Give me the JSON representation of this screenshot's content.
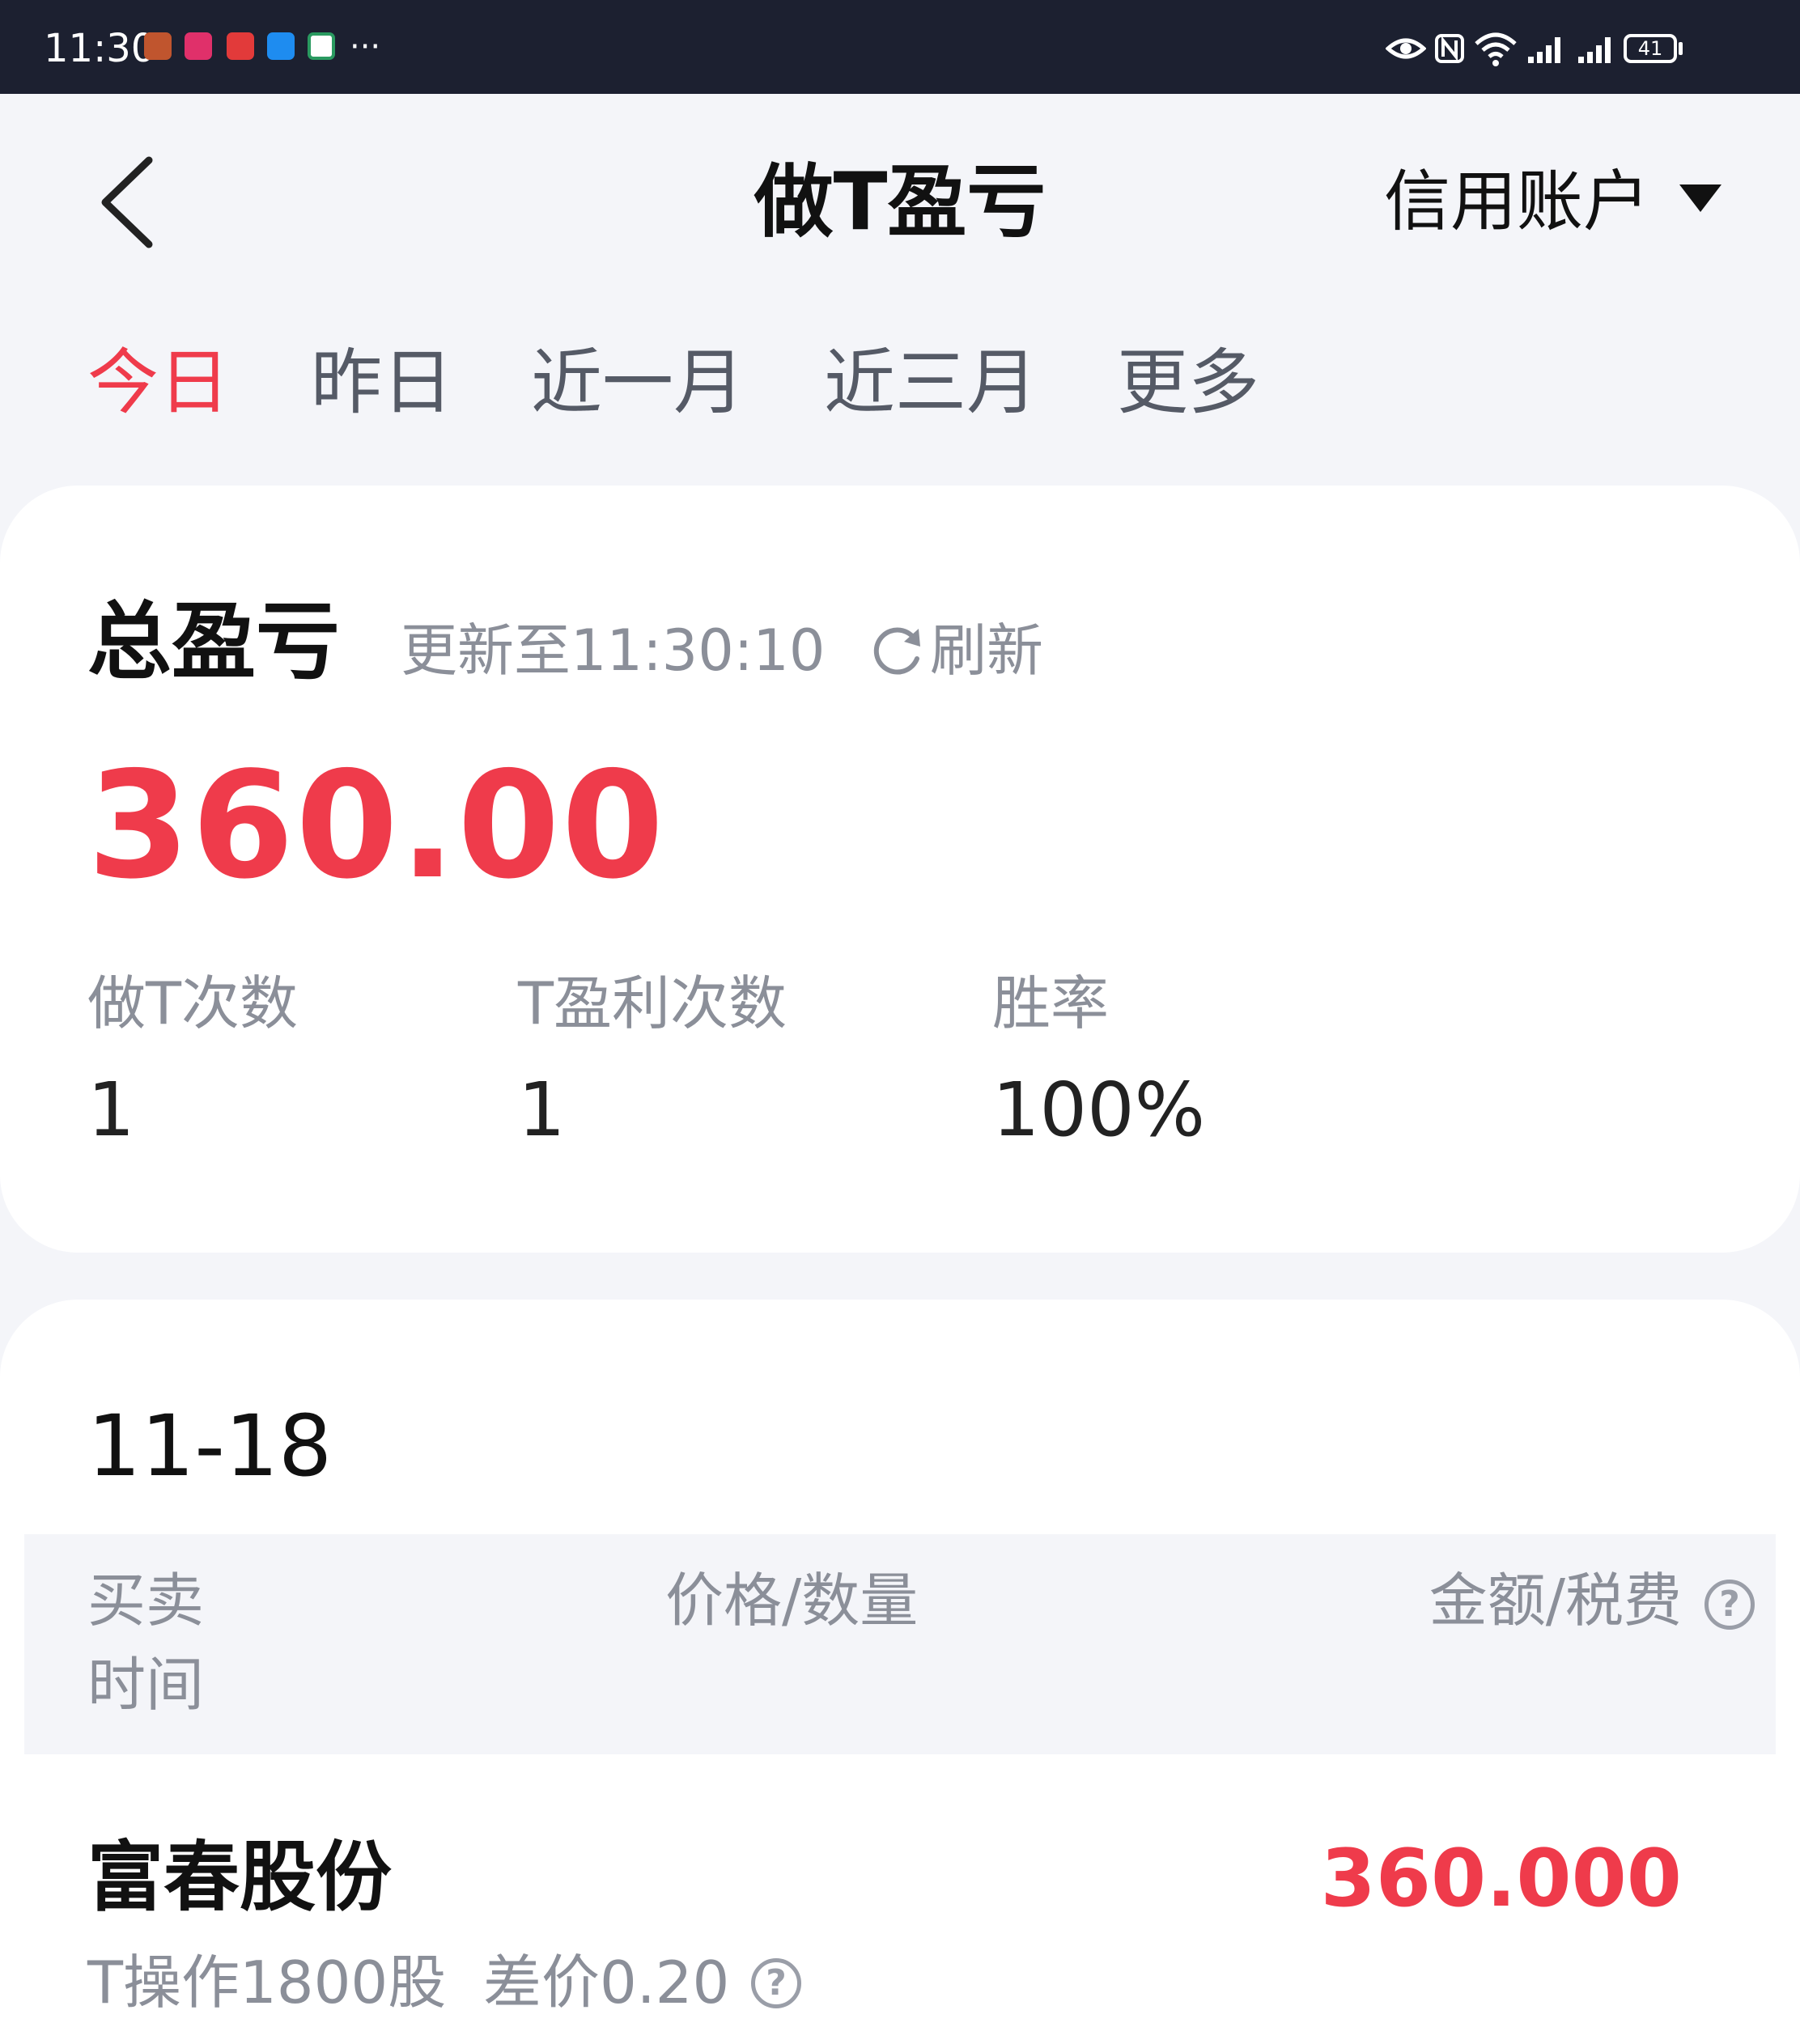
{
  "status_bar": {
    "time": "11:30",
    "more": "···",
    "battery": "41",
    "icons": [
      "avatar-app-icon",
      "ledger-app-icon",
      "mail-app-icon",
      "message-app-icon",
      "bank-app-icon",
      "eye-icon",
      "nfc-icon",
      "wifi-icon",
      "signal-icon",
      "signal-icon",
      "battery-icon"
    ]
  },
  "header": {
    "title": "做T盈亏",
    "account_selector": "信用账户"
  },
  "tabs": [
    {
      "label": "今日",
      "active": true
    },
    {
      "label": "昨日",
      "active": false
    },
    {
      "label": "近一月",
      "active": false
    },
    {
      "label": "近三月",
      "active": false
    },
    {
      "label": "更多",
      "active": false
    }
  ],
  "summary": {
    "title": "总盈亏",
    "updated": "更新至11:30:10",
    "refresh": "刷新",
    "total": "360.00",
    "stats": [
      {
        "label": "做T次数",
        "value": "1"
      },
      {
        "label": "T盈利次数",
        "value": "1"
      },
      {
        "label": "胜率",
        "value": "100%"
      }
    ]
  },
  "records": {
    "date": "11-18",
    "columns": {
      "time": "买卖时间",
      "price_qty": "价格/数量",
      "amount_fee": "金额/税费"
    },
    "items": [
      {
        "name": "富春股份",
        "amount": "360.000",
        "detail": "T操作1800股  差价0.20"
      }
    ]
  },
  "colors": {
    "accent": "#ef3b4b",
    "status_bar": "#1c2030",
    "background": "#f4f5f9"
  }
}
